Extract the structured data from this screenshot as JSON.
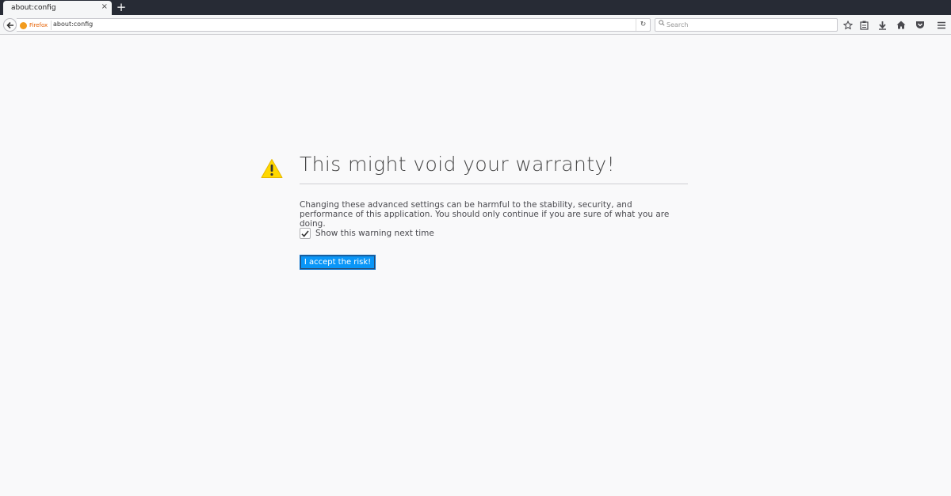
{
  "tab": {
    "title": "about:config",
    "close_glyph": "×"
  },
  "new_tab_glyph": "+",
  "urlbar": {
    "identity_label": "Firefox",
    "url": "about:config"
  },
  "search": {
    "placeholder": "Search"
  },
  "toolbar_icons": [
    "bookmark-star-icon",
    "library-icon",
    "download-icon",
    "home-icon",
    "pocket-icon",
    "menu-icon"
  ],
  "page": {
    "title": "This might void your warranty!",
    "description": "Changing these advanced settings can be harmful to the stability, security, and performance of this application. You should only continue if you are sure of what you are doing.",
    "checkbox_label": "Show this warning next time",
    "checkbox_checked": true,
    "accept_button": "I accept the risk!"
  },
  "colors": {
    "accent": "#0996f8",
    "warning": "#ffd800",
    "tabbar": "#272b35"
  }
}
